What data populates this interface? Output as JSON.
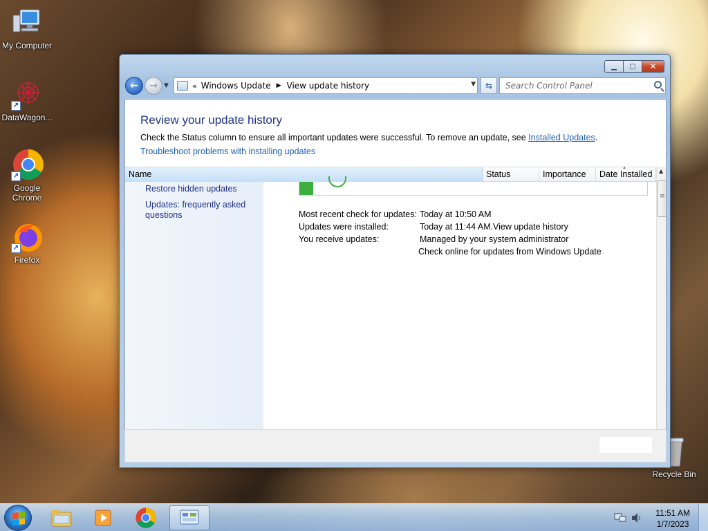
{
  "desktop": {
    "icons": [
      {
        "label": "My Computer"
      },
      {
        "label": "DataWagon..."
      },
      {
        "label": "Google Chrome"
      },
      {
        "label": "Firefox"
      },
      {
        "label": "Recycle Bin"
      }
    ]
  },
  "window": {
    "address": {
      "chevron": "«",
      "crumb1": "Windows Update",
      "separator": "▶",
      "crumb2": "View update history"
    },
    "search_placeholder": "Search Control Panel",
    "page_title": "Review your update history",
    "description": "Check the Status column to ensure all important updates were successful. To remove an update, see ",
    "installed_updates_link": "Installed Updates",
    "description_end": ".",
    "troubleshoot_link": "Troubleshoot problems with installing updates",
    "columns": {
      "name": "Name",
      "status": "Status",
      "importance": "Importance",
      "date_installed": "Date Installed"
    },
    "left_pane": {
      "restore_hidden": "Restore hidden updates",
      "faq": "Updates: frequently asked questions"
    },
    "info": {
      "recent_check_label": "Most recent check for updates:",
      "recent_check_value": "Today at 10:50 AM",
      "installed_label": "Updates were installed:",
      "installed_value": "Today at 11:44 AM.",
      "view_history_link": "View update history",
      "receive_label": "You receive updates:",
      "receive_value": "Managed by your system administrator",
      "check_online_link": "Check online for updates from Windows Update"
    }
  },
  "taskbar": {
    "time": "11:51 AM",
    "date": "1/7/2023"
  },
  "colors": {
    "accent_link": "#1f5fb0",
    "title_blue": "#1e3287",
    "status_green": "#3eae3e"
  }
}
